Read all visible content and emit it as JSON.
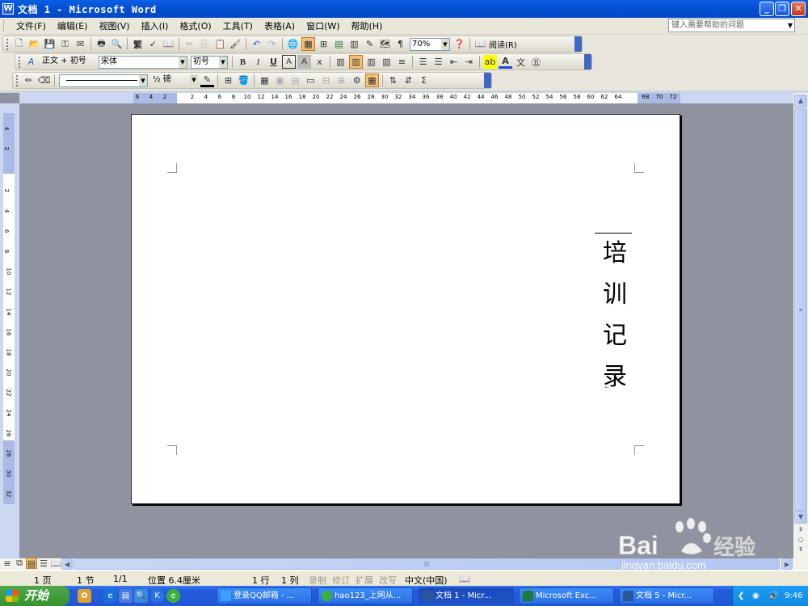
{
  "window": {
    "title": "文档 1 - Microsoft Word",
    "app_icon": "W",
    "buttons": [
      "_",
      "❐",
      "✕"
    ]
  },
  "menu": {
    "items": [
      "文件(F)",
      "编辑(E)",
      "视图(V)",
      "插入(I)",
      "格式(O)",
      "工具(T)",
      "表格(A)",
      "窗口(W)",
      "帮助(H)"
    ],
    "help_placeholder": "键入需要帮助的问题"
  },
  "toolbar_standard": {
    "zoom": "70%",
    "read_label": "阅读(R)"
  },
  "toolbar_format": {
    "style": "正文 + 初号",
    "font": "宋体",
    "size": "初号"
  },
  "toolbar_drawing": {
    "line_weight": "½ 磅"
  },
  "ruler": {
    "h_ticks": [
      "6",
      "4",
      "2",
      "2",
      "4",
      "6",
      "8",
      "10",
      "12",
      "14",
      "16",
      "18",
      "20",
      "22",
      "24",
      "26",
      "28",
      "30",
      "32",
      "34",
      "36",
      "38",
      "40",
      "42",
      "44",
      "46",
      "48",
      "50",
      "52",
      "54",
      "56",
      "58",
      "60",
      "62",
      "64",
      "68",
      "70",
      "72"
    ],
    "v_ticks": [
      "4",
      "2",
      "2",
      "4",
      "6",
      "8",
      "10",
      "12",
      "14",
      "16",
      "18",
      "20",
      "22",
      "24",
      "26",
      "28",
      "30",
      "32"
    ]
  },
  "document": {
    "chars": [
      "培",
      "训",
      "记",
      "录"
    ],
    "para_mark": "↵"
  },
  "status": {
    "page": "1 页",
    "section": "1 节",
    "pages": "1/1",
    "position": "位置 6.4厘米",
    "line": "1 行",
    "column": "1 列",
    "modes": [
      "录制",
      "修订",
      "扩展",
      "改写"
    ],
    "language": "中文(中国)"
  },
  "taskbar": {
    "start_label": "开始",
    "tasks": [
      {
        "label": "登录QQ邮箱 - ...",
        "color": "#3aa0ff"
      },
      {
        "label": "hao123_上网从...",
        "color": "#3bb03a"
      },
      {
        "label": "文档 1 - Micr...",
        "color": "#2b579a",
        "active": true
      },
      {
        "label": "Microsoft Exc...",
        "color": "#1f7a3a"
      },
      {
        "label": "文档 5 - Micr...",
        "color": "#2b579a"
      }
    ],
    "clock": "9:46"
  },
  "watermark": {
    "brand": "Baidu经验",
    "url": "jingyan.baidu.com"
  }
}
